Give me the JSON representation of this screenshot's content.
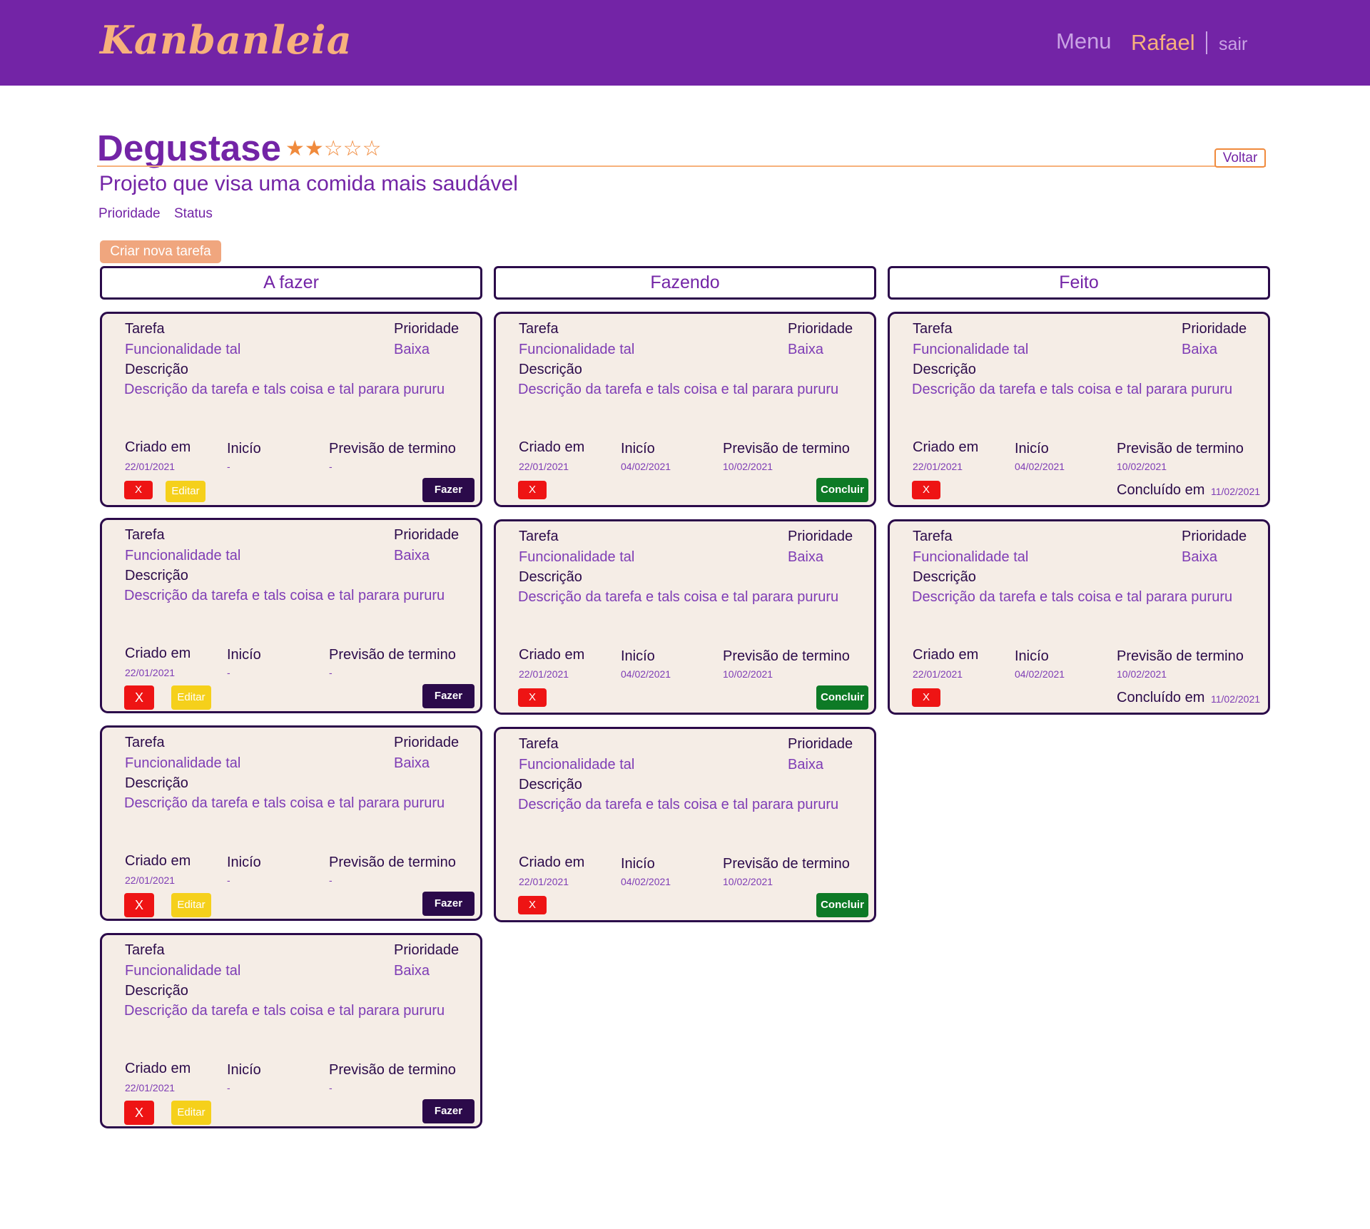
{
  "navbar": {
    "logo": "Kanbanleia",
    "menu": "Menu",
    "user": "Rafael",
    "logout": "sair"
  },
  "project": {
    "title": "Degustase",
    "rating": 2,
    "rating_max": 5,
    "stars": "★★☆☆☆",
    "description": "Projeto que visa uma comida mais saudável",
    "back_label": "Voltar",
    "filter_priority": "Prioridade",
    "filter_status": "Status",
    "new_task_label": "Criar nova tarefa"
  },
  "card_labels": {
    "task": "Tarefa",
    "priority": "Prioridade",
    "description": "Descrição",
    "created": "Criado em",
    "start": "Inicío",
    "due": "Previsão de termino",
    "completed": "Concluído em",
    "delete": "X",
    "edit": "Editar",
    "do": "Fazer",
    "finish": "Concluir"
  },
  "colors": {
    "brand": "#7324a6",
    "accent": "#f7b17c",
    "card_bg": "#f5ede6",
    "delete": "#ee1414",
    "edit": "#f5d01b",
    "do": "#2b0a4a",
    "finish": "#0d7a26"
  },
  "columns": [
    {
      "title": "A fazer",
      "cards": [
        {
          "name": "Funcionalidade tal",
          "priority": "Baixa",
          "description": "Descrição da tarefa e tals coisa e tal parara pururu",
          "created": "22/01/2021",
          "start": "-",
          "due": "-"
        },
        {
          "name": "Funcionalidade tal",
          "priority": "Baixa",
          "description": "Descrição da tarefa e tals coisa e tal parara pururu",
          "created": "22/01/2021",
          "start": "-",
          "due": "-"
        },
        {
          "name": "Funcionalidade tal",
          "priority": "Baixa",
          "description": "Descrição da tarefa e tals coisa e tal parara pururu",
          "created": "22/01/2021",
          "start": "-",
          "due": "-"
        },
        {
          "name": "Funcionalidade tal",
          "priority": "Baixa",
          "description": "Descrição da tarefa e tals coisa e tal parara pururu",
          "created": "22/01/2021",
          "start": "-",
          "due": "-"
        }
      ]
    },
    {
      "title": "Fazendo",
      "cards": [
        {
          "name": "Funcionalidade tal",
          "priority": "Baixa",
          "description": "Descrição da tarefa e tals coisa e tal parara pururu",
          "created": "22/01/2021",
          "start": "04/02/2021",
          "due": "10/02/2021"
        },
        {
          "name": "Funcionalidade tal",
          "priority": "Baixa",
          "description": "Descrição da tarefa e tals coisa e tal parara pururu",
          "created": "22/01/2021",
          "start": "04/02/2021",
          "due": "10/02/2021"
        },
        {
          "name": "Funcionalidade tal",
          "priority": "Baixa",
          "description": "Descrição da tarefa e tals coisa e tal parara pururu",
          "created": "22/01/2021",
          "start": "04/02/2021",
          "due": "10/02/2021"
        }
      ]
    },
    {
      "title": "Feito",
      "cards": [
        {
          "name": "Funcionalidade tal",
          "priority": "Baixa",
          "description": "Descrição da tarefa e tals coisa e tal parara pururu",
          "created": "22/01/2021",
          "start": "04/02/2021",
          "due": "10/02/2021",
          "completed": "11/02/2021"
        },
        {
          "name": "Funcionalidade tal",
          "priority": "Baixa",
          "description": "Descrição da tarefa e tals coisa e tal parara pururu",
          "created": "22/01/2021",
          "start": "04/02/2021",
          "due": "10/02/2021",
          "completed": "11/02/2021"
        }
      ]
    }
  ]
}
